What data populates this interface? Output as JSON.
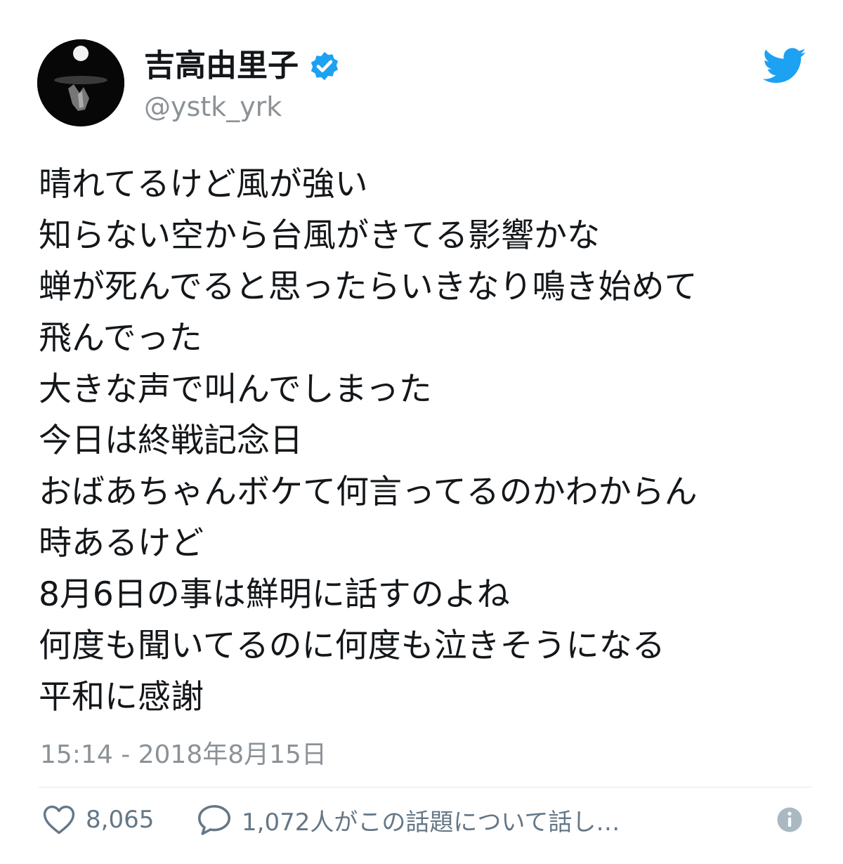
{
  "user": {
    "display_name": "吉高由里子",
    "handle": "@ystk_yrk",
    "verified": true,
    "avatar_icon": "avatar-dark-photo"
  },
  "tweet": {
    "lines": [
      "晴れてるけど風が強い",
      "知らない空から台風がきてる影響かな",
      "蝉が死んでると思ったらいきなり鳴き始めて",
      "飛んでった",
      "大きな声で叫んでしまった",
      "今日は終戦記念日",
      "おばあちゃんボケて何言ってるのかわからん",
      "時あるけど",
      "8月6日の事は鮮明に話すのよね",
      "何度も聞いてるのに何度も泣きそうになる",
      "平和に感謝"
    ],
    "timestamp": "15:14 - 2018年8月15日"
  },
  "actions": {
    "likes": "8,065",
    "replies": "1,072人がこの話題について話し…"
  },
  "colors": {
    "twitter_blue": "#1da1f2",
    "text": "#14171a",
    "muted": "#8b9297",
    "icon_gray": "#657786"
  }
}
